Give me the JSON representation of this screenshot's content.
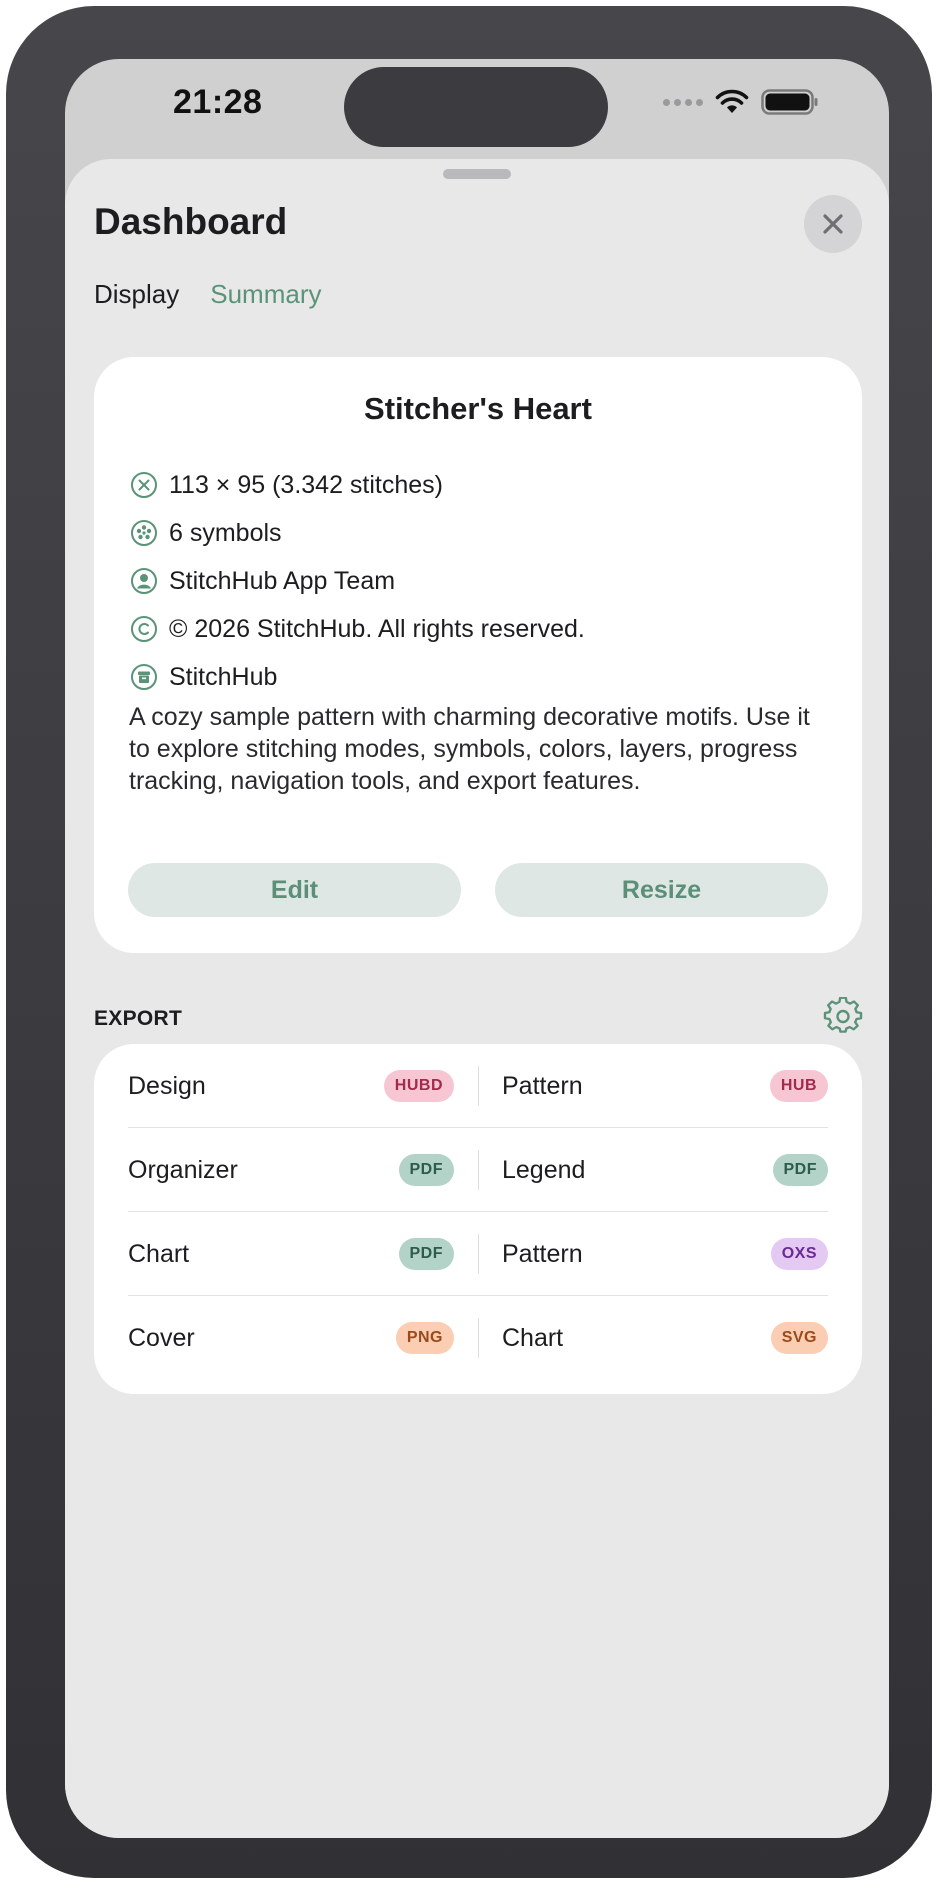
{
  "status_bar": {
    "time": "21:28"
  },
  "sheet": {
    "title": "Dashboard",
    "tabs": [
      {
        "label": "Display",
        "active": false
      },
      {
        "label": "Summary",
        "active": true
      }
    ]
  },
  "pattern": {
    "title": "Stitcher's Heart",
    "info": [
      {
        "icon": "stitch-x-icon",
        "text": "113 × 95 (3.342 stitches)"
      },
      {
        "icon": "palette-icon",
        "text": "6 symbols"
      },
      {
        "icon": "person-icon",
        "text": "StitchHub App Team"
      },
      {
        "icon": "copyright-icon",
        "text": "© 2026 StitchHub. All rights reserved."
      },
      {
        "icon": "archive-icon",
        "text": "StitchHub"
      }
    ],
    "description": "A cozy sample pattern with charming decorative motifs. Use it to explore stitching modes, symbols, colors, layers, progress tracking, navigation tools, and export features.",
    "edit_label": "Edit",
    "resize_label": "Resize"
  },
  "export": {
    "heading": "EXPORT",
    "rows": [
      {
        "left": {
          "label": "Design",
          "badge": "HUBD",
          "badge_bg": "#f6c7d3",
          "badge_fg": "#a12a4e"
        },
        "right": {
          "label": "Pattern",
          "badge": "HUB",
          "badge_bg": "#f6c7d3",
          "badge_fg": "#a12a4e"
        }
      },
      {
        "left": {
          "label": "Organizer",
          "badge": "PDF",
          "badge_bg": "#b3d3c8",
          "badge_fg": "#2d5c4c"
        },
        "right": {
          "label": "Legend",
          "badge": "PDF",
          "badge_bg": "#b3d3c8",
          "badge_fg": "#2d5c4c"
        }
      },
      {
        "left": {
          "label": "Chart",
          "badge": "PDF",
          "badge_bg": "#b3d3c8",
          "badge_fg": "#2d5c4c"
        },
        "right": {
          "label": "Pattern",
          "badge": "OXS",
          "badge_bg": "#e4c9f3",
          "badge_fg": "#6b2a92"
        }
      },
      {
        "left": {
          "label": "Cover",
          "badge": "PNG",
          "badge_bg": "#fbcdb2",
          "badge_fg": "#9a4a1c"
        },
        "right": {
          "label": "Chart",
          "badge": "SVG",
          "badge_bg": "#fbcdb2",
          "badge_fg": "#9a4a1c"
        }
      }
    ]
  },
  "colors": {
    "accent": "#5b9378",
    "button_bg": "#dfe7e4",
    "sheet_bg": "#e8e8e9"
  }
}
